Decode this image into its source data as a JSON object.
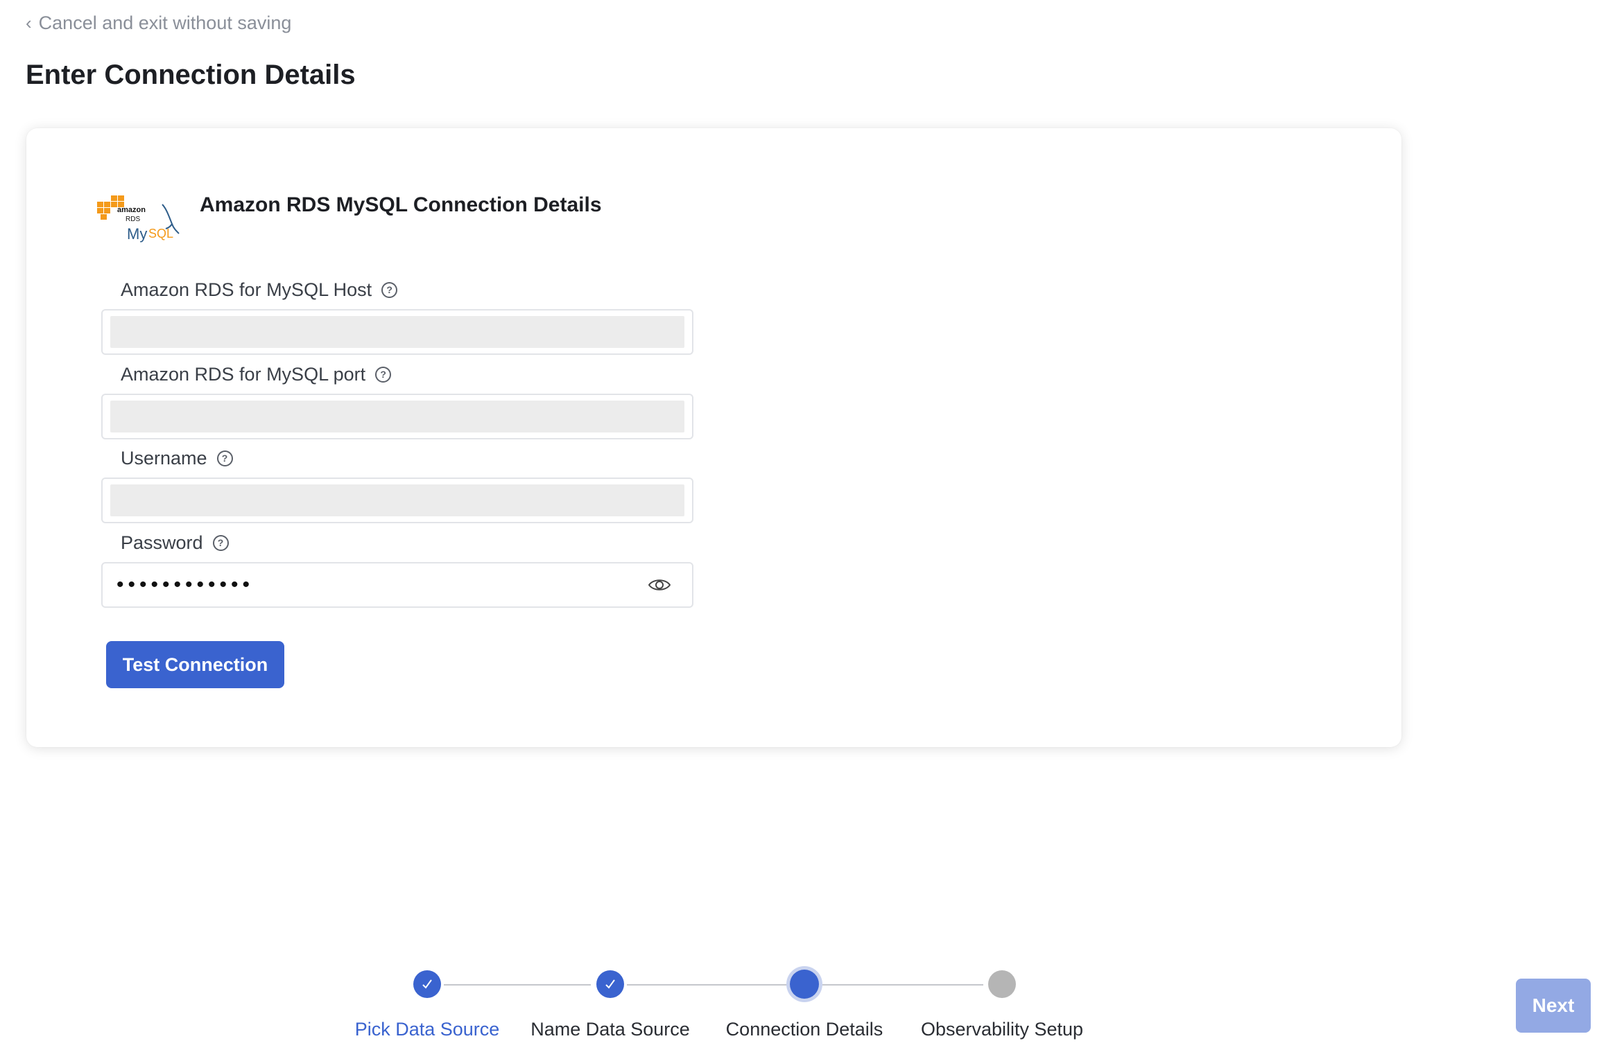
{
  "nav": {
    "back_label": "Cancel and exit without saving"
  },
  "page": {
    "title": "Enter Connection Details"
  },
  "card": {
    "title": "Amazon RDS MySQL Connection Details",
    "logo": {
      "line1": "amazon",
      "line2": "RDS",
      "brand_a": "My",
      "brand_b": "SQL"
    },
    "fields": [
      {
        "label": "Amazon RDS for MySQL Host",
        "value": "",
        "placeholder": ""
      },
      {
        "label": "Amazon RDS for MySQL port",
        "value": "",
        "placeholder": ""
      },
      {
        "label": "Username",
        "value": "",
        "placeholder": ""
      },
      {
        "label": "Password",
        "value": "••••••••••••"
      }
    ],
    "help_icon": "?",
    "test_button": "Test Connection"
  },
  "stepper": {
    "steps": [
      {
        "label": "Pick Data Source",
        "state": "complete"
      },
      {
        "label": "Name Data Source",
        "state": "complete"
      },
      {
        "label": "Connection Details",
        "state": "active"
      },
      {
        "label": "Observability Setup",
        "state": "pending"
      }
    ]
  },
  "footer": {
    "next_button": "Next"
  },
  "colors": {
    "primary": "#3a63cf",
    "next_disabled": "#93a9e4",
    "aws_orange": "#f49a1a",
    "mysql_blue": "#2e5d8a"
  }
}
